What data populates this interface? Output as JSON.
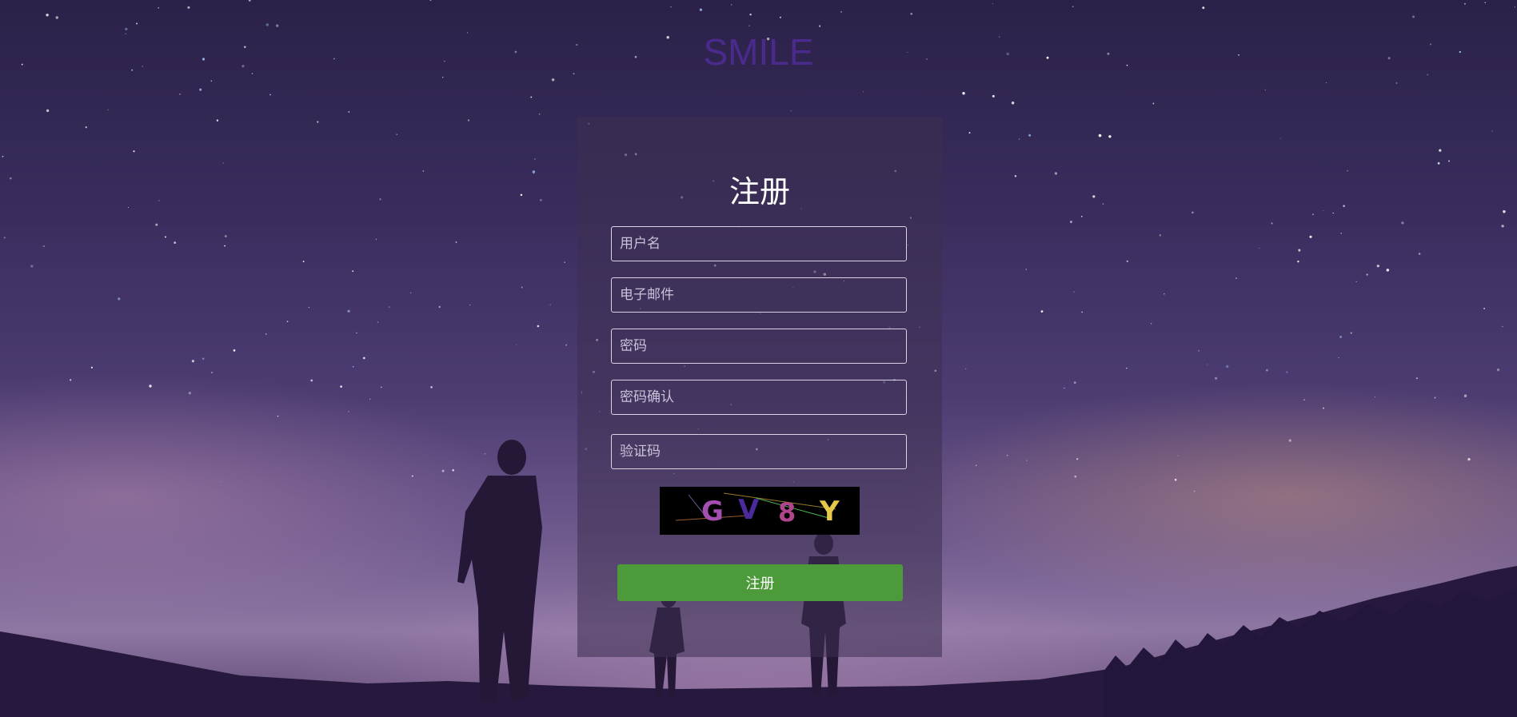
{
  "brand": {
    "name": "SMILE"
  },
  "form": {
    "title": "注册",
    "fields": [
      {
        "placeholder": "用户名",
        "value": ""
      },
      {
        "placeholder": "电子邮件",
        "value": ""
      },
      {
        "placeholder": "密码",
        "value": ""
      },
      {
        "placeholder": "密码确认",
        "value": ""
      },
      {
        "placeholder": "验证码",
        "value": ""
      }
    ],
    "captcha": {
      "characters": [
        "G",
        "V",
        "8",
        "Y"
      ],
      "colors": [
        "#a24fb0",
        "#4a2a9c",
        "#b0458c",
        "#e6c84a"
      ]
    },
    "submit_label": "注册"
  },
  "colors": {
    "brand": "#4a2a8c",
    "submit_button": "#4c9a3a",
    "field_border": "#d9d3e6"
  }
}
